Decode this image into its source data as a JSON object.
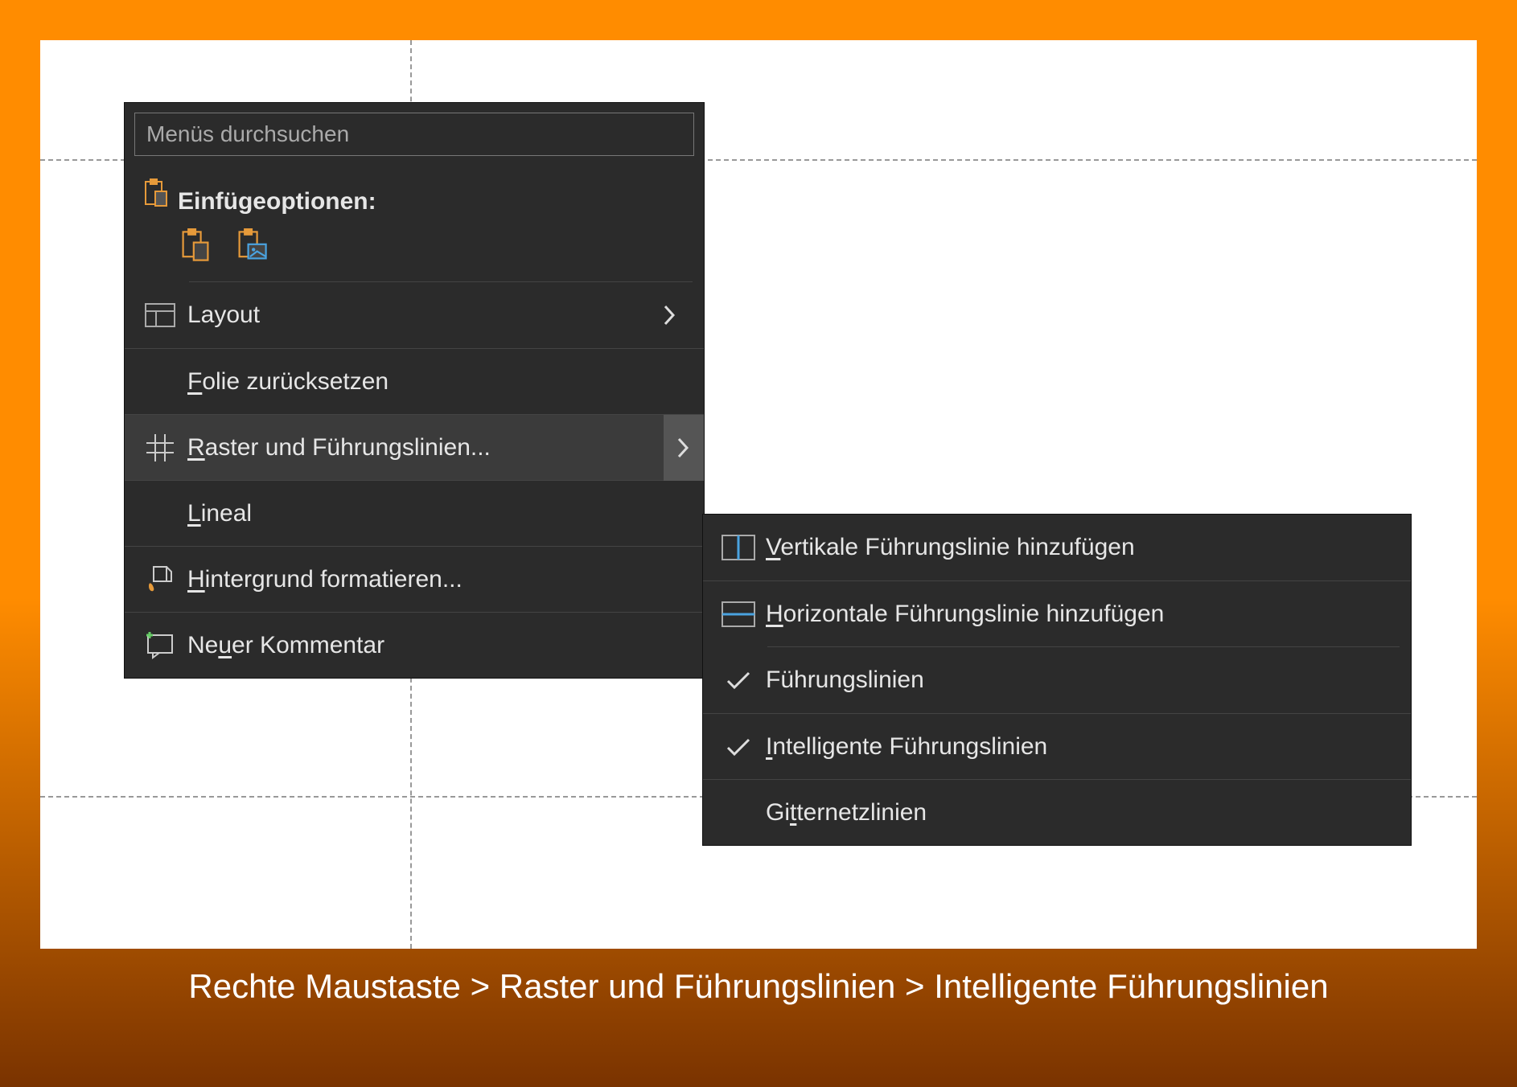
{
  "menu_search_placeholder": "Menüs durchsuchen",
  "paste_section_label": "Einfügeoptionen:",
  "main_menu": {
    "layout": "Layout",
    "reset_slide": "Folie zurücksetzen",
    "grid_guides": "Raster und Führungslinien...",
    "ruler": "Lineal",
    "format_background": "Hintergrund formatieren...",
    "new_comment": "Neuer Kommentar"
  },
  "submenu": {
    "add_vertical": "Vertikale Führungslinie hinzufügen",
    "add_horizontal": "Horizontale Führungslinie hinzufügen",
    "guides": "Führungslinien",
    "smart_guides": "Intelligente Führungslinien",
    "gridlines": "Gitternetzlinien"
  },
  "caption": "Rechte Maustaste > Raster und Führungslinien > Intelligente Führungslinien"
}
